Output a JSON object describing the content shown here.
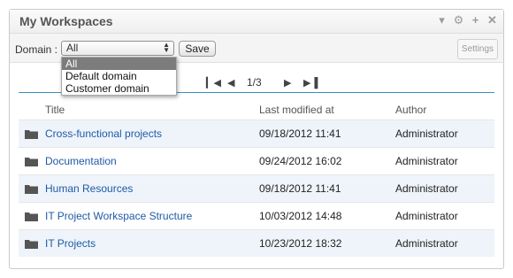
{
  "widget": {
    "title": "My Workspaces",
    "header_icons": [
      "chevron-down-icon",
      "gear-icon",
      "plus-icon",
      "close-icon"
    ]
  },
  "toolbar": {
    "domain_label": "Domain :",
    "domain_selected": "All",
    "save_label": "Save",
    "settings_label": "Settings"
  },
  "dropdown": {
    "options": [
      "All",
      "Default domain",
      "Customer domain"
    ]
  },
  "pager": {
    "pages": "1/3"
  },
  "table": {
    "columns": [
      "Title",
      "Last modified at",
      "Author"
    ],
    "rows": [
      {
        "title": "Cross-functional projects",
        "modified": "09/18/2012 11:41",
        "author": "Administrator"
      },
      {
        "title": "Documentation",
        "modified": "09/24/2012 16:02",
        "author": "Administrator"
      },
      {
        "title": "Human Resources",
        "modified": "09/18/2012 11:41",
        "author": "Administrator"
      },
      {
        "title": "IT Project Workspace Structure",
        "modified": "10/03/2012 14:48",
        "author": "Administrator"
      },
      {
        "title": "IT Projects",
        "modified": "10/23/2012 18:32",
        "author": "Administrator"
      }
    ]
  },
  "colors": {
    "link": "#1f5aa6",
    "pager_rule": "#3a8fc4",
    "row_alt": "#eef4fa",
    "dropdown_selected": "#7c7c7c"
  }
}
